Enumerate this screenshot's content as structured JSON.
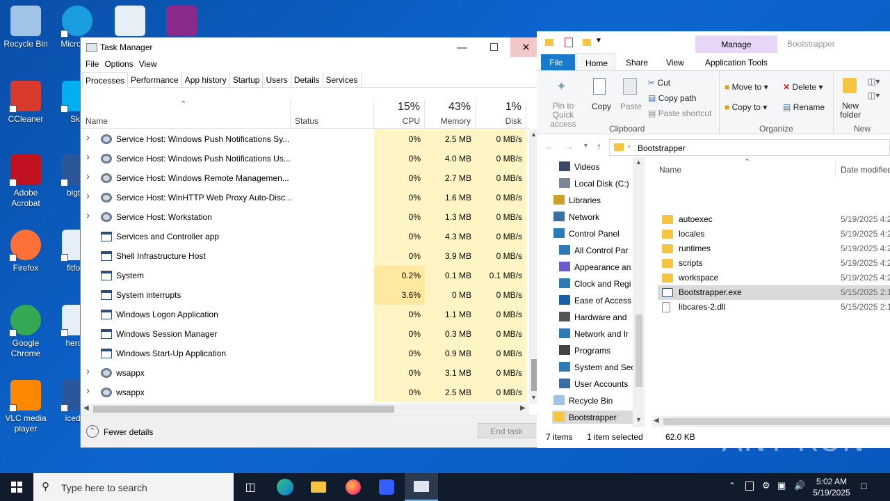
{
  "desktop": {
    "icons": [
      {
        "label": "Recycle Bin",
        "icon": "recycle-bin-icon"
      },
      {
        "label": "Micro Ed",
        "icon": "edge-icon"
      },
      {
        "label": "",
        "icon": "image-file-icon"
      },
      {
        "label": "",
        "icon": "winrar-icon"
      },
      {
        "label": "CCleaner",
        "icon": "ccleaner-icon"
      },
      {
        "label": "Sky",
        "icon": "skype-icon"
      },
      {
        "label": "Adobe Acrobat",
        "icon": "acrobat-icon"
      },
      {
        "label": "bigtru",
        "icon": "word-doc-icon"
      },
      {
        "label": "Firefox",
        "icon": "firefox-icon"
      },
      {
        "label": "fitforu",
        "icon": "image-file-icon"
      },
      {
        "label": "Google Chrome",
        "icon": "chrome-icon"
      },
      {
        "label": "heropi",
        "icon": "image-file-icon"
      },
      {
        "label": "VLC media player",
        "icon": "vlc-icon"
      },
      {
        "label": "icedes",
        "icon": "word-doc-icon"
      }
    ]
  },
  "task_manager": {
    "title": "Task Manager",
    "menu": [
      "File",
      "Options",
      "View"
    ],
    "tabs": [
      "Processes",
      "Performance",
      "App history",
      "Startup",
      "Users",
      "Details",
      "Services"
    ],
    "active_tab": "Processes",
    "columns": {
      "name": "Name",
      "status": "Status",
      "cpu": {
        "pct": "15%",
        "label": "CPU"
      },
      "memory": {
        "pct": "43%",
        "label": "Memory"
      },
      "disk": {
        "pct": "1%",
        "label": "Disk"
      }
    },
    "rows": [
      {
        "name": "Service Host: Windows Push Notifications Sy...",
        "expandable": true,
        "icon": "gear",
        "cpu": "0%",
        "memory": "2.5 MB",
        "disk": "0 MB/s"
      },
      {
        "name": "Service Host: Windows Push Notifications Us...",
        "expandable": true,
        "icon": "gear",
        "cpu": "0%",
        "memory": "4.0 MB",
        "disk": "0 MB/s"
      },
      {
        "name": "Service Host: Windows Remote Managemen...",
        "expandable": true,
        "icon": "gear",
        "cpu": "0%",
        "memory": "2.7 MB",
        "disk": "0 MB/s"
      },
      {
        "name": "Service Host: WinHTTP Web Proxy Auto-Disc...",
        "expandable": true,
        "icon": "gear",
        "cpu": "0%",
        "memory": "1.6 MB",
        "disk": "0 MB/s"
      },
      {
        "name": "Service Host: Workstation",
        "expandable": true,
        "icon": "gear",
        "cpu": "0%",
        "memory": "1.3 MB",
        "disk": "0 MB/s"
      },
      {
        "name": "Services and Controller app",
        "expandable": false,
        "icon": "win",
        "cpu": "0%",
        "memory": "4.3 MB",
        "disk": "0 MB/s"
      },
      {
        "name": "Shell Infrastructure Host",
        "expandable": false,
        "icon": "win",
        "cpu": "0%",
        "memory": "3.9 MB",
        "disk": "0 MB/s"
      },
      {
        "name": "System",
        "expandable": false,
        "icon": "win",
        "cpu": "0.2%",
        "memory": "0.1 MB",
        "disk": "0.1 MB/s"
      },
      {
        "name": "System interrupts",
        "expandable": false,
        "icon": "win",
        "cpu": "3.6%",
        "memory": "0 MB",
        "disk": "0 MB/s"
      },
      {
        "name": "Windows Logon Application",
        "expandable": false,
        "icon": "win",
        "cpu": "0%",
        "memory": "1.1 MB",
        "disk": "0 MB/s"
      },
      {
        "name": "Windows Session Manager",
        "expandable": false,
        "icon": "win",
        "cpu": "0%",
        "memory": "0.3 MB",
        "disk": "0 MB/s"
      },
      {
        "name": "Windows Start-Up Application",
        "expandable": false,
        "icon": "win",
        "cpu": "0%",
        "memory": "0.9 MB",
        "disk": "0 MB/s"
      },
      {
        "name": "wsappx",
        "expandable": true,
        "icon": "gear",
        "cpu": "0%",
        "memory": "3.1 MB",
        "disk": "0 MB/s"
      },
      {
        "name": "wsappx",
        "expandable": true,
        "icon": "gear",
        "cpu": "0%",
        "memory": "2.5 MB",
        "disk": "0 MB/s"
      }
    ],
    "fewer_details": "Fewer details",
    "end_task": "End task"
  },
  "explorer": {
    "manage_tab": "Manage",
    "window_title": "Bootstrapper",
    "ribbon_tabs": [
      "File",
      "Home",
      "Share",
      "View",
      "Application Tools"
    ],
    "clipboard": {
      "pin": "Pin to Quick access",
      "copy": "Copy",
      "paste": "Paste",
      "cut": "Cut",
      "copy_path": "Copy path",
      "paste_shortcut": "Paste shortcut",
      "group": "Clipboard"
    },
    "organize": {
      "move_to": "Move to",
      "copy_to": "Copy to",
      "delete": "Delete",
      "rename": "Rename",
      "group": "Organize"
    },
    "new": {
      "new_folder": "New folder",
      "group": "New"
    },
    "address": "Bootstrapper",
    "nav_items": [
      {
        "label": "Videos",
        "indent": 1
      },
      {
        "label": "Local Disk (C:)",
        "indent": 1
      },
      {
        "label": "Libraries",
        "indent": 0
      },
      {
        "label": "Network",
        "indent": 0
      },
      {
        "label": "Control Panel",
        "indent": 0
      },
      {
        "label": "All Control Par",
        "indent": 1
      },
      {
        "label": "Appearance an",
        "indent": 1
      },
      {
        "label": "Clock and Regi",
        "indent": 1
      },
      {
        "label": "Ease of Access",
        "indent": 1
      },
      {
        "label": "Hardware and",
        "indent": 1
      },
      {
        "label": "Network and Ir",
        "indent": 1
      },
      {
        "label": "Programs",
        "indent": 1
      },
      {
        "label": "System and Sec",
        "indent": 1
      },
      {
        "label": "User Accounts",
        "indent": 1
      },
      {
        "label": "Recycle Bin",
        "indent": 0
      },
      {
        "label": "Bootstrapper",
        "indent": 0,
        "selected": true
      }
    ],
    "columns": {
      "name": "Name",
      "date": "Date modified"
    },
    "files": [
      {
        "name": "autoexec",
        "type": "folder",
        "date": "5/19/2025 4:2"
      },
      {
        "name": "locales",
        "type": "folder",
        "date": "5/19/2025 4:2"
      },
      {
        "name": "runtimes",
        "type": "folder",
        "date": "5/19/2025 4:2"
      },
      {
        "name": "scripts",
        "type": "folder",
        "date": "5/19/2025 4:2"
      },
      {
        "name": "workspace",
        "type": "folder",
        "date": "5/19/2025 4:2"
      },
      {
        "name": "Bootstrapper.exe",
        "type": "exe",
        "date": "5/15/2025 2:1",
        "selected": true
      },
      {
        "name": "libcares-2.dll",
        "type": "dll",
        "date": "5/15/2025 2:1"
      }
    ],
    "status": {
      "count": "7 items",
      "selected": "1 item selected",
      "size": "62.0 KB"
    }
  },
  "taskbar": {
    "search_placeholder": "Type here to search",
    "time": "5:02 AM",
    "date": "5/19/2025"
  },
  "watermark": "ANY RUN",
  "colors": {
    "cpu_cell": "#fff4c4",
    "cpu_cell_hot": "#ffe8a0",
    "ribbon_file": "#1979ca",
    "manage_tab": "#e8d6f7",
    "taskbar": "#101c2c",
    "selection": "#cce8ff"
  }
}
